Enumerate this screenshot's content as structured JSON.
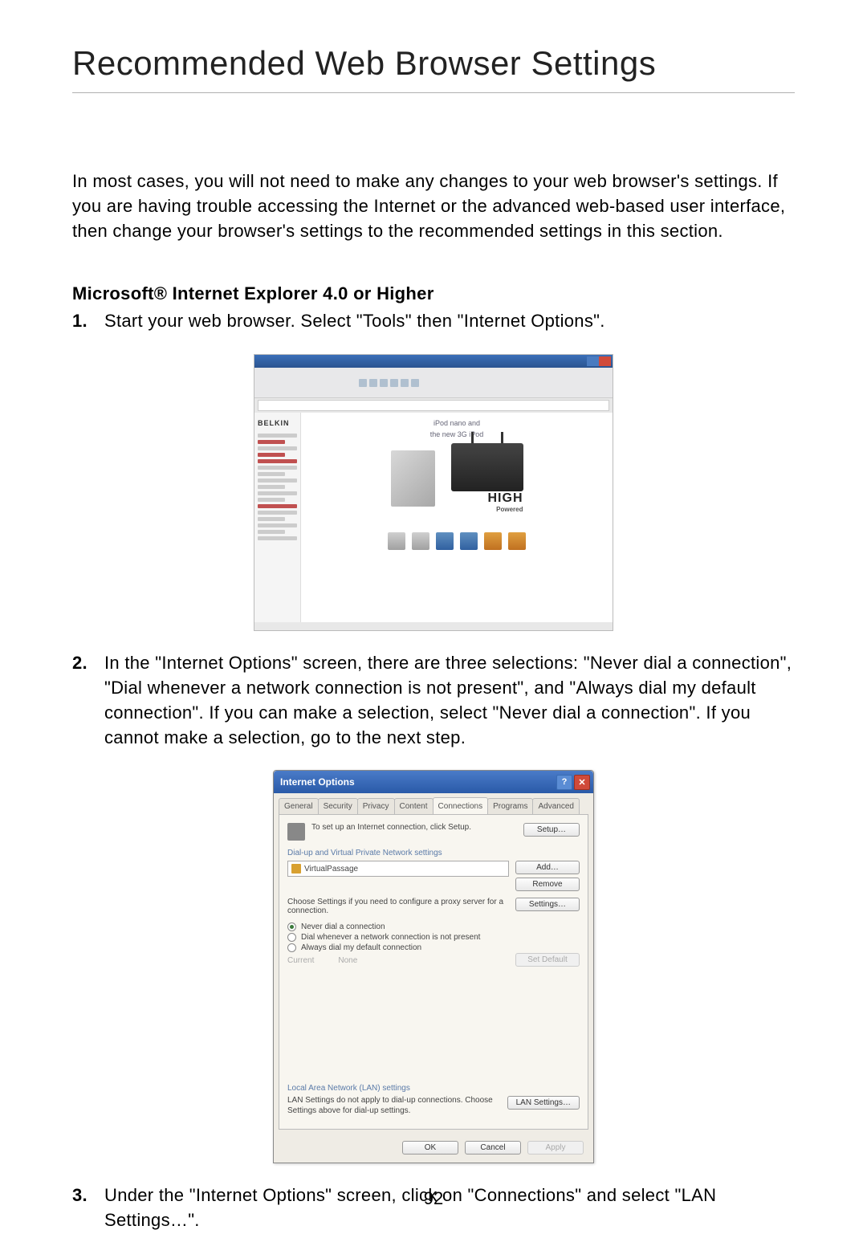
{
  "page": {
    "title": "Recommended Web Browser Settings",
    "intro": "In most cases, you will not need to make any changes to your web browser's settings. If you are having trouble accessing the Internet or the advanced web-based user interface, then change your browser's settings to the recommended settings in this section.",
    "subheading": "Microsoft® Internet Explorer 4.0 or Higher",
    "step1_num": "1.",
    "step1_text": "Start your web browser. Select \"Tools\" then \"Internet Options\".",
    "step2_num": "2.",
    "step2_text": "In the \"Internet Options\" screen, there are three selections: \"Never dial a connection\", \"Dial whenever a network connection is not present\", and \"Always dial my default connection\". If you can make a selection, select \"Never dial a connection\". If you cannot make a selection, go to the next step.",
    "step3_num": "3.",
    "step3_text": "Under the \"Internet Options\" screen, click on \"Connections\" and select \"LAN Settings…\".",
    "page_number": "92"
  },
  "fig1": {
    "belkin": "BELKIN",
    "ipod_line1": "iPod nano and",
    "ipod_line2": "the new 3G iPod",
    "high": "HIGH",
    "powered": "Powered"
  },
  "fig2": {
    "title": "Internet Options",
    "help_btn": "?",
    "close_btn": "✕",
    "tabs": {
      "general": "General",
      "security": "Security",
      "privacy": "Privacy",
      "content": "Content",
      "connections": "Connections",
      "programs": "Programs",
      "advanced": "Advanced"
    },
    "setup_text": "To set up an Internet connection, click Setup.",
    "setup_btn": "Setup…",
    "vpn_section": "Dial-up and Virtual Private Network settings",
    "vpn_item": "VirtualPassage",
    "add_btn": "Add…",
    "remove_btn": "Remove",
    "proxy_text": "Choose Settings if you need to configure a proxy server for a connection.",
    "settings_btn": "Settings…",
    "radio1": "Never dial a connection",
    "radio2": "Dial whenever a network connection is not present",
    "radio3": "Always dial my default connection",
    "current_label": "Current",
    "none_label": "None",
    "set_default_btn": "Set Default",
    "lan_section": "Local Area Network (LAN) settings",
    "lan_text": "LAN Settings do not apply to dial-up connections. Choose Settings above for dial-up settings.",
    "lan_btn": "LAN Settings…",
    "ok_btn": "OK",
    "cancel_btn": "Cancel",
    "apply_btn": "Apply"
  }
}
